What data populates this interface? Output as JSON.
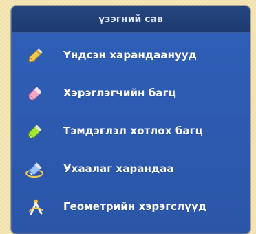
{
  "panel": {
    "title": "үзэгний сав",
    "items": [
      {
        "label": "Үндсэн харандаанууд",
        "icon": "yellow-pencil-icon"
      },
      {
        "label": "Хэрэглэгчийн багц",
        "icon": "pink-pencil-icon"
      },
      {
        "label": "Тэмдэглэл хөтлөх багц",
        "icon": "green-marker-icon"
      },
      {
        "label": "Ухаалаг харандаа",
        "icon": "smart-pencil-icon"
      },
      {
        "label": "Геометрийн хэрэгслүүд",
        "icon": "compass-icon"
      }
    ]
  },
  "colors": {
    "background": "#f6e6b4",
    "panel": "#2f5fb8",
    "header": "#24457e",
    "text": "#ffffff",
    "accent_yellow": "#f2c94c",
    "accent_pink": "#f2a6c6",
    "accent_green": "#a3e635",
    "accent_blue": "#7aa6ff"
  }
}
